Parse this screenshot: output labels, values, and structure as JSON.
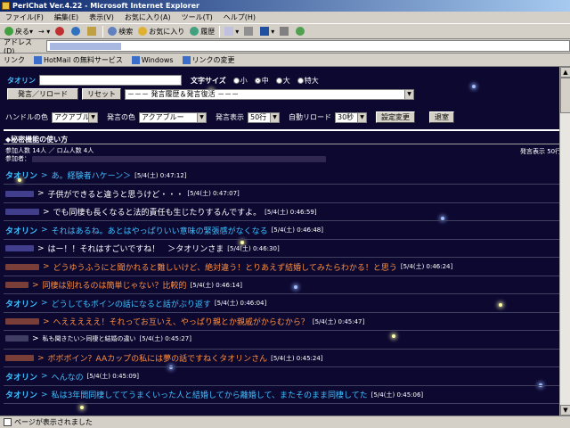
{
  "window": {
    "title": "PeriChat Ver.4.22 - Microsoft Internet Explorer"
  },
  "menu": [
    "ファイル(F)",
    "編集(E)",
    "表示(V)",
    "お気に入り(A)",
    "ツール(T)",
    "ヘルプ(H)"
  ],
  "toolbar": {
    "back": "戻る",
    "search": "検索",
    "favorites": "お気に入り",
    "history": "履歴"
  },
  "address": {
    "label": "アドレス(D)"
  },
  "links": {
    "label": "リンク",
    "items": [
      "HotMail の無料サービス",
      "Windows",
      "リンクの変更"
    ]
  },
  "form": {
    "name_label": "タオリン",
    "size_label": "文字サイズ",
    "sizes": [
      "小",
      "中",
      "大",
      "特大"
    ],
    "selected_size": "中",
    "post_reload_button": "発言／リロード",
    "reset_button": "リセット",
    "history_select": "－－－ 発言履歴＆発言復活 －－－",
    "handle_color_label": "ハンドルの色",
    "handle_color_value": "アクアブルー",
    "post_color_label": "発言の色",
    "post_color_value": "アクアブルー",
    "display_label": "発言表示",
    "display_value": "50行",
    "auto_reload_label": "自動リロード",
    "auto_reload_value": "30秒",
    "settings_button": "設定変更",
    "exit_button": "退室"
  },
  "howto": "◆秘密機能の使い方",
  "room": {
    "participants": "参加人数 14人 ／ ロム人数 4人",
    "participants_label": "参加者：",
    "display_count": "発言表示 50行"
  },
  "messages": [
    {
      "name": "タオリン",
      "name_color": "#40c0ff",
      "text": "あ。経験者ハケーン＞",
      "color": "#40c0ff",
      "time": "[5/4(土) 0:47:12]"
    },
    {
      "name": "",
      "name_color": "#8080ff",
      "text": "子供ができると違うと思うけど・・・",
      "color": "#ffffff",
      "time": "[5/4(土) 0:47:07]"
    },
    {
      "name": "",
      "name_color": "#8080ff",
      "text": "でも同棲も長くなると法的責任も生じたりするんですよ。",
      "color": "#ffffff",
      "time": "[5/4(土) 0:46:59]"
    },
    {
      "name": "タオリン",
      "name_color": "#40c0ff",
      "text": "それはあるね。あとはやっぱりいい意味の緊張感がなくなる",
      "color": "#40c0ff",
      "time": "[5/4(土) 0:46:48]"
    },
    {
      "name": "",
      "name_color": "#8080ff",
      "text": "はー！！それはすごいですね！　＞タオリンさま",
      "color": "#ffffff",
      "time": "[5/4(土) 0:46:30]"
    },
    {
      "name": "",
      "name_color": "#ff8040",
      "text": "どうゆうふうにと聞かれると難しいけど、絶対違う！とりあえず結婚してみたらわかる！と思う",
      "color": "#ff9040",
      "time": "[5/4(土) 0:46:24]"
    },
    {
      "name": "",
      "name_color": "#ff8040",
      "text": "同棲は別れるのは簡単じゃない？比較的",
      "color": "#ff9040",
      "time": "[5/4(土) 0:46:14]"
    },
    {
      "name": "タオリン",
      "name_color": "#40c0ff",
      "text": "どうしてもボインの話になると話がぶり返す",
      "color": "#40c0ff",
      "time": "[5/4(土) 0:46:04]"
    },
    {
      "name": "",
      "name_color": "#ff8040",
      "text": "へえええええ！それってお互いえ、やっぱり親とか親戚がからむから？",
      "color": "#ff9040",
      "time": "[5/4(土) 0:45:47]"
    },
    {
      "name": "",
      "name_color": "#8080a0",
      "text": "私も聞きたい＞同棲と結婚の違い",
      "color": "#ffffff",
      "time": "[5/4(土) 0:45:27]"
    },
    {
      "name": "",
      "name_color": "#ff8040",
      "text": "ボボボイン？AAカップの私には夢の話ですねくタオリンさん",
      "color": "#ff9040",
      "time": "[5/4(土) 0:45:24]"
    },
    {
      "name": "タオリン",
      "name_color": "#40c0ff",
      "text": "へんなの",
      "color": "#40c0ff",
      "time": "[5/4(土) 0:45:09]"
    },
    {
      "name": "タオリン",
      "name_color": "#40c0ff",
      "text": "私は3年間同棲しててうまくいった人と結婚してから離婚して、またそのまま同棲してた",
      "color": "#40c0ff",
      "time": "[5/4(土) 0:45:06]"
    }
  ],
  "status": "ページが表示されました"
}
